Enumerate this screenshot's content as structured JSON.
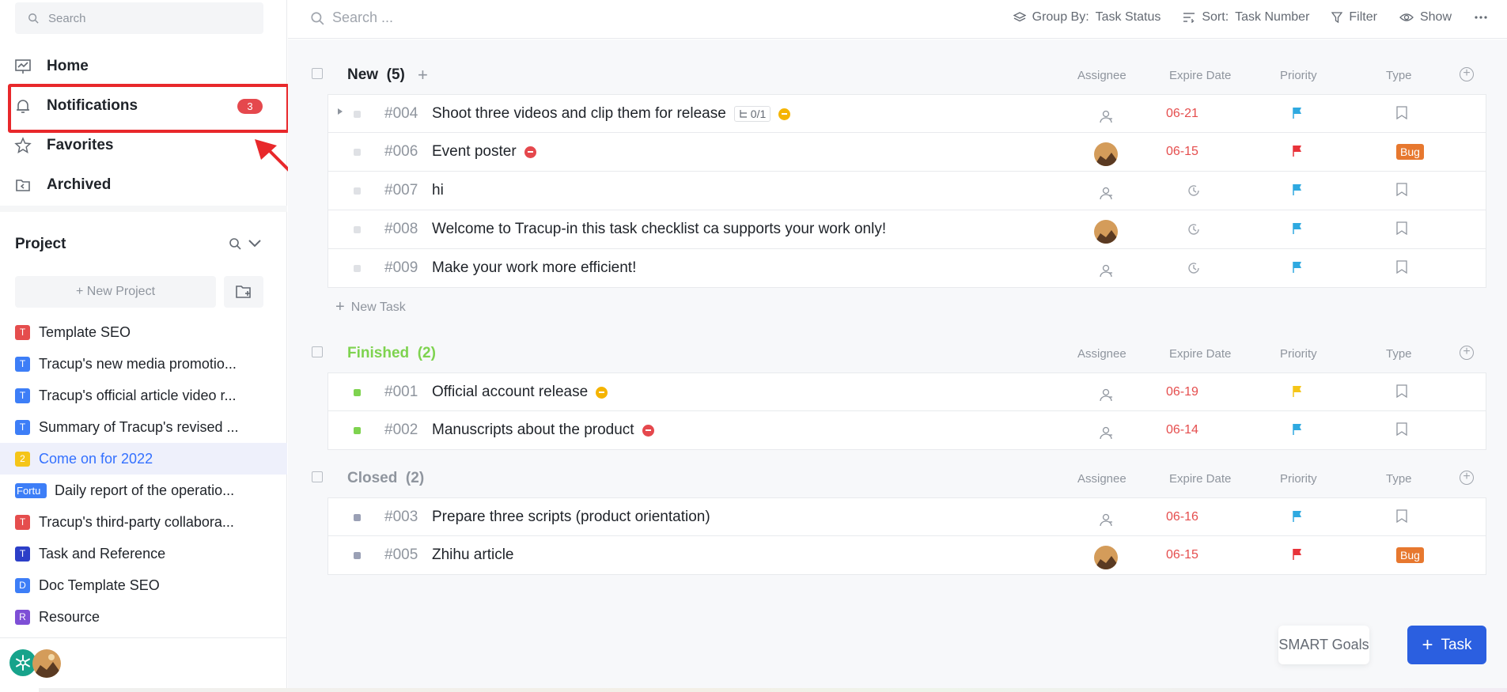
{
  "sidebar": {
    "search_placeholder": "Search",
    "nav": [
      {
        "label": "Home",
        "icon": "chart-screen-icon"
      },
      {
        "label": "Notifications",
        "icon": "bell-icon",
        "badge": "3"
      },
      {
        "label": "Favorites",
        "icon": "star-icon"
      },
      {
        "label": "Archived",
        "icon": "archive-icon"
      }
    ],
    "project_title": "Project",
    "new_project_label": "+ New Project",
    "projects": [
      {
        "icon_text": "T",
        "icon_color": "#e54d4d",
        "label": "Template SEO"
      },
      {
        "icon_text": "T",
        "icon_color": "#3d7ef7",
        "label": "Tracup's new media promotio..."
      },
      {
        "icon_text": "T",
        "icon_color": "#3d7ef7",
        "label": "Tracup's official article video r..."
      },
      {
        "icon_text": "T",
        "icon_color": "#3d7ef7",
        "label": "Summary of Tracup's revised ..."
      },
      {
        "icon_text": "2",
        "icon_color": "#f5c518",
        "label": "Come on for 2022"
      },
      {
        "icon_text": "Fortu",
        "icon_color": "#3d7ef7",
        "label": "Daily report of the operatio..."
      },
      {
        "icon_text": "T",
        "icon_color": "#e54d4d",
        "label": "Tracup's third-party collabora..."
      },
      {
        "icon_text": "T",
        "icon_color": "#2c3fc8",
        "label": "Task and Reference"
      },
      {
        "icon_text": "D",
        "icon_color": "#3d7ef7",
        "label": "Doc Template SEO"
      },
      {
        "icon_text": "R",
        "icon_color": "#7e4fd6",
        "label": "Resource"
      }
    ]
  },
  "topbar": {
    "search_placeholder": "Search ...",
    "group_by_label": "Group By:",
    "group_by_value": "Task Status",
    "sort_label": "Sort:",
    "sort_value": "Task Number",
    "filter_label": "Filter",
    "show_label": "Show"
  },
  "columns": {
    "assignee": "Assignee",
    "expire": "Expire Date",
    "priority": "Priority",
    "type": "Type"
  },
  "groups": [
    {
      "title": "New",
      "count": "(5)",
      "color": "#1f2329",
      "tasks": [
        {
          "num": "#004",
          "title": "Shoot three videos and clip them for release",
          "subtasks": "0/1",
          "status": "yellow",
          "date": "06-21",
          "priority": "blue",
          "type": "",
          "avatar": false
        },
        {
          "num": "#006",
          "title": "Event poster",
          "status": "red",
          "date": "06-15",
          "priority": "red",
          "type": "Bug",
          "avatar": true
        },
        {
          "num": "#007",
          "title": "hi",
          "status": "",
          "date": "",
          "priority": "blue",
          "type": "",
          "avatar": false
        },
        {
          "num": "#008",
          "title": "Welcome to Tracup-in this task checklist ca supports your work only!",
          "status": "",
          "date": "",
          "priority": "blue",
          "type": "",
          "avatar": true
        },
        {
          "num": "#009",
          "title": "Make your work more efficient!",
          "status": "",
          "date": "",
          "priority": "blue",
          "type": "",
          "avatar": false
        }
      ],
      "new_task_label": "New Task"
    },
    {
      "title": "Finished",
      "count": "(2)",
      "color": "#7ed34f",
      "tasks": [
        {
          "num": "#001",
          "title": "Official account release",
          "status": "yellow",
          "date": "06-19",
          "priority": "yellow",
          "type": "",
          "avatar": false
        },
        {
          "num": "#002",
          "title": "Manuscripts about the product",
          "status": "red",
          "date": "06-14",
          "priority": "blue",
          "type": "",
          "avatar": false
        }
      ]
    },
    {
      "title": "Closed",
      "count": "(2)",
      "color": "#8f959e",
      "tasks": [
        {
          "num": "#003",
          "title": "Prepare three scripts (product orientation)",
          "status": "",
          "date": "06-16",
          "priority": "blue",
          "type": "",
          "avatar": false
        },
        {
          "num": "#005",
          "title": "Zhihu article",
          "status": "",
          "date": "06-15",
          "priority": "red",
          "type": "Bug",
          "avatar": true
        }
      ]
    }
  ],
  "footer_buttons": {
    "smart_goals": "SMART Goals",
    "task": "Task"
  },
  "colors": {
    "accent": "#2b5fe0",
    "flag_blue": "#2fa9e0",
    "flag_red": "#e8333a",
    "flag_yellow": "#f5c518",
    "status_yellow": "#f5b400",
    "status_red": "#e5484d"
  }
}
